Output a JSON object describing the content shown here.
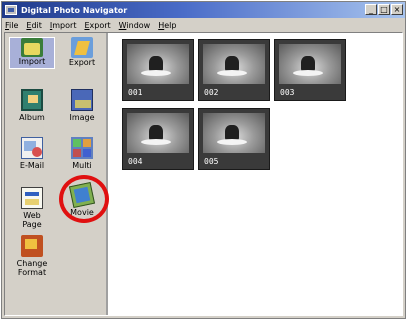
{
  "window": {
    "title": "Digital Photo Navigator",
    "controls": {
      "minimize": "_",
      "maximize": "□",
      "close": "×"
    }
  },
  "menu": [
    {
      "first": "F",
      "rest": "ile"
    },
    {
      "first": "E",
      "rest": "dit"
    },
    {
      "first": "I",
      "rest": "mport"
    },
    {
      "first": "E",
      "rest": "xport"
    },
    {
      "first": "W",
      "rest": "indow"
    },
    {
      "first": "H",
      "rest": "elp"
    }
  ],
  "sidebar": {
    "tabs": [
      {
        "label": "Import",
        "icon": "import-icon",
        "active": true
      },
      {
        "label": "Export",
        "icon": "export-icon",
        "active": false
      }
    ],
    "tools": [
      {
        "label": "Album",
        "icon": "album-icon"
      },
      {
        "label": "Image",
        "icon": "image-icon"
      },
      {
        "label": "E-Mail",
        "icon": "email-icon"
      },
      {
        "label": "Multi",
        "icon": "multi-icon"
      },
      {
        "label": "Web\nPage",
        "icon": "web-page-icon"
      },
      {
        "label": "Movie",
        "icon": "movie-icon",
        "highlighted": true
      },
      {
        "label": "Change\nFormat",
        "icon": "change-format-icon"
      }
    ]
  },
  "gallery": {
    "thumbnails": [
      {
        "caption": "001"
      },
      {
        "caption": "002"
      },
      {
        "caption": "003"
      },
      {
        "caption": "004"
      },
      {
        "caption": "005"
      }
    ]
  },
  "colors": {
    "title_bar": "#1f3a8a",
    "highlight_ring": "#e01010",
    "active_tab": "#a8b0d8"
  }
}
